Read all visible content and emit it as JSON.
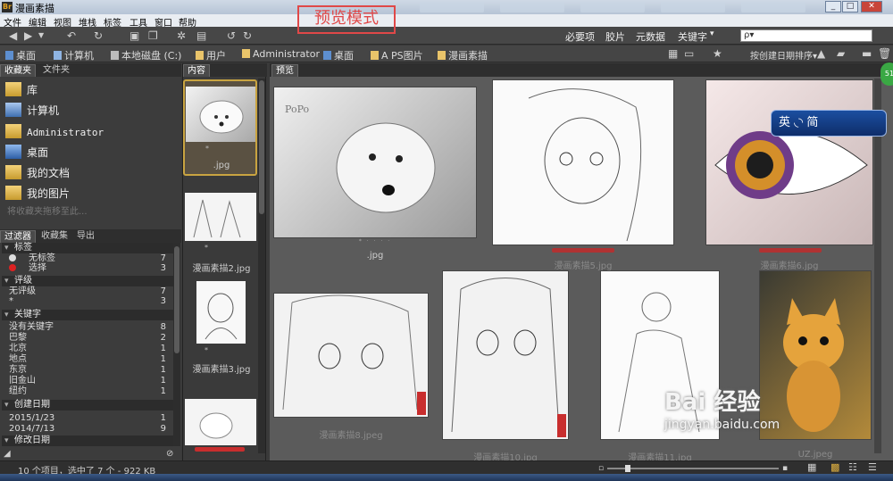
{
  "window": {
    "title": "漫画素描",
    "app_icon_label": "Br"
  },
  "preview_note": "预览模式",
  "menu": [
    "文件",
    "编辑",
    "视图",
    "堆栈",
    "标签",
    "工具",
    "窗口",
    "帮助"
  ],
  "toolbar": {
    "workspaces": [
      "必要项",
      "胶片",
      "元数据",
      "关键字"
    ],
    "keyword_menu_arrow": "▾",
    "search_placeholder": "ρ▾"
  },
  "breadcrumb": {
    "items": [
      "桌面",
      "计算机",
      "本地磁盘 (C:)",
      "用户",
      "Administrator",
      "桌面",
      "A PS图片",
      "漫画素描"
    ],
    "sort_label": "按创建日期排序",
    "sort_arrow": "▾"
  },
  "left_panel": {
    "tabs": [
      "收藏夹",
      "文件夹"
    ],
    "favorites": [
      {
        "label": "库",
        "icon": "library-icon"
      },
      {
        "label": "计算机",
        "icon": "computer-icon"
      },
      {
        "label": "Administrator",
        "icon": "user-folder-icon"
      },
      {
        "label": "桌面",
        "icon": "desktop-icon"
      },
      {
        "label": "我的文档",
        "icon": "documents-icon"
      },
      {
        "label": "我的图片",
        "icon": "pictures-icon"
      }
    ],
    "drag_hint": "将收藏夹拖移至此...",
    "filter_tabs": [
      "过滤器",
      "收藏集",
      "导出"
    ],
    "filters": [
      {
        "header": "标签",
        "rows": [
          {
            "label": "无标签",
            "count": "7"
          },
          {
            "label": "选择",
            "count": "3"
          }
        ]
      },
      {
        "header": "评级",
        "rows": [
          {
            "label": "无评级",
            "count": "7"
          },
          {
            "label": "*",
            "count": "3"
          }
        ]
      },
      {
        "header": "关键字",
        "rows": [
          {
            "label": "没有关键字",
            "count": "8"
          },
          {
            "label": "巴黎",
            "count": "2"
          },
          {
            "label": "北京",
            "count": "1"
          },
          {
            "label": "地点",
            "count": "1"
          },
          {
            "label": "东京",
            "count": "1"
          },
          {
            "label": "旧金山",
            "count": "1"
          },
          {
            "label": "纽约",
            "count": "1"
          }
        ]
      },
      {
        "header": "创建日期",
        "rows": [
          {
            "label": "2015/1/23",
            "count": "1"
          },
          {
            "label": "2014/7/13",
            "count": "9"
          }
        ]
      },
      {
        "header": "修改日期",
        "rows": []
      }
    ]
  },
  "content_panel": {
    "tab": "内容",
    "thumbs": [
      {
        "caption": ".jpg",
        "stars": "*"
      },
      {
        "caption": "漫画素描2.jpg",
        "stars": "*"
      },
      {
        "caption": "漫画素描3.jpg",
        "stars": "*"
      },
      {
        "caption": "",
        "stars": ""
      }
    ]
  },
  "preview_panel": {
    "tab": "预览",
    "items": [
      {
        "caption": ".jpg",
        "stars": "* · · · ·",
        "dim": false
      },
      {
        "caption": "漫画素描5.jpg",
        "stars": "",
        "dim": true
      },
      {
        "caption": "漫画素描6.jpg",
        "stars": "",
        "dim": true
      },
      {
        "caption": "漫画素描8.jpeg",
        "stars": "",
        "dim": true
      },
      {
        "caption": "漫画素描10.jpg",
        "stars": "",
        "dim": true
      },
      {
        "caption": "漫画素描11.jpg",
        "stars": "",
        "dim": true
      },
      {
        "caption": "UZ.jpeg",
        "stars": "",
        "dim": true
      }
    ]
  },
  "status": {
    "text": "10 个项目，选中了 7 个 - 922 KB"
  },
  "ime": {
    "label": "英 ◟◝ 简"
  },
  "badge": "51",
  "watermark": {
    "brand": "Bai  经验",
    "url": "jingyan.baidu.com"
  },
  "colors": {
    "selection": "#c9a441",
    "label_red": "#b03232",
    "background": "#5b5b5b"
  }
}
